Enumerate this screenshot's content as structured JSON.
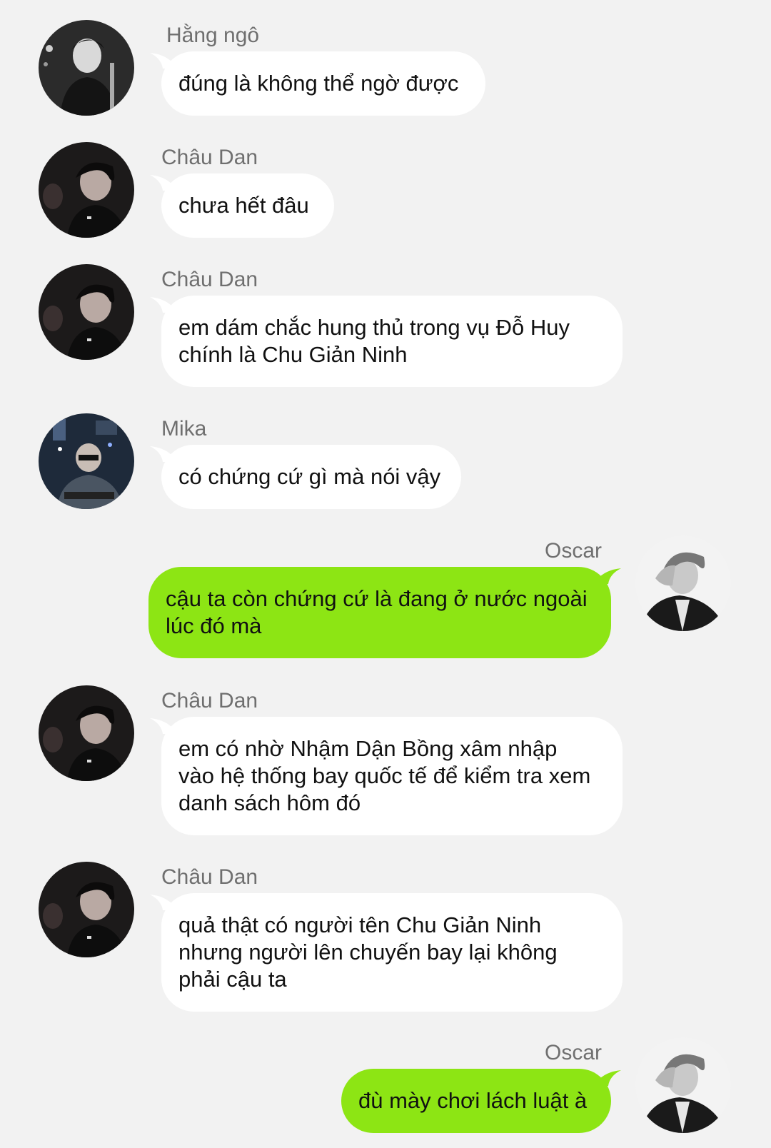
{
  "colors": {
    "background": "#f2f2f2",
    "incoming_bubble": "#ffffff",
    "outgoing_bubble": "#8de514",
    "sender_name": "#6f6f6f"
  },
  "messages": [
    {
      "sender": "Hằng ngô",
      "side": "left",
      "avatar": "avatar-hang-ngo",
      "lines": [
        "đúng là không thể ngờ được"
      ]
    },
    {
      "sender": "Châu Dan",
      "side": "left",
      "avatar": "avatar-chau-dan",
      "lines": [
        "chưa hết đâu"
      ]
    },
    {
      "sender": "Châu Dan",
      "side": "left",
      "avatar": "avatar-chau-dan",
      "lines": [
        "em dám chắc hung thủ trong vụ Đỗ Huy",
        "chính là Chu Giản Ninh"
      ]
    },
    {
      "sender": "Mika",
      "side": "left",
      "avatar": "avatar-mika",
      "lines": [
        "có chứng cứ gì mà nói vậy"
      ]
    },
    {
      "sender": "Oscar",
      "side": "right",
      "avatar": "avatar-oscar",
      "lines": [
        "cậu ta còn chứng cứ là đang ở nước ngoài",
        "lúc đó mà"
      ]
    },
    {
      "sender": "Châu Dan",
      "side": "left",
      "avatar": "avatar-chau-dan",
      "lines": [
        "em có nhờ Nhậm Dận Bồng xâm nhập",
        "vào hệ thống bay quốc tế để kiểm tra xem",
        "danh sách hôm đó"
      ]
    },
    {
      "sender": "Châu Dan",
      "side": "left",
      "avatar": "avatar-chau-dan",
      "lines": [
        "quả thật có người tên Chu Giản Ninh",
        "nhưng người lên chuyến bay lại không",
        "phải cậu ta"
      ]
    },
    {
      "sender": "Oscar",
      "side": "right",
      "avatar": "avatar-oscar",
      "lines": [
        "đù mày chơi lách luật à"
      ]
    }
  ]
}
